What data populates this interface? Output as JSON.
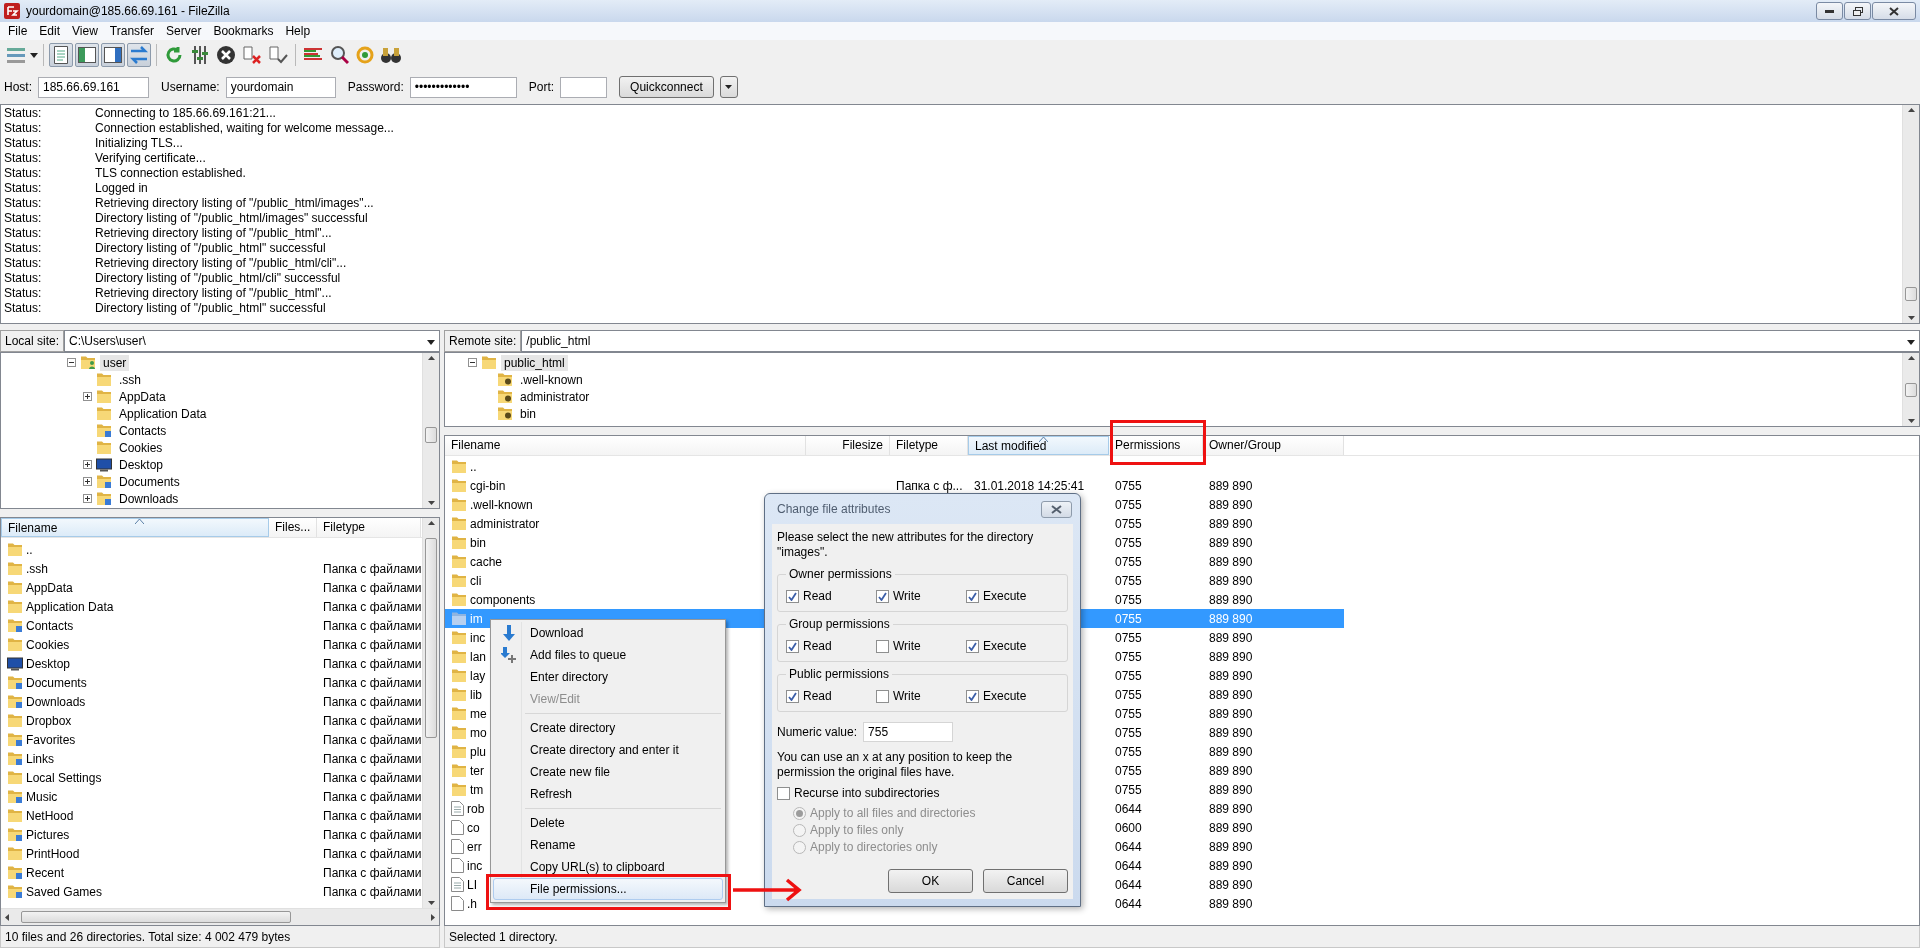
{
  "window": {
    "title": "yourdomain@185.66.69.161 - FileZilla"
  },
  "menu": [
    "File",
    "Edit",
    "View",
    "Transfer",
    "Server",
    "Bookmarks",
    "Help"
  ],
  "quickconnect": {
    "fields": [
      {
        "label": "Host:",
        "value": "185.66.69.161"
      },
      {
        "label": "Username:",
        "value": "yourdomain"
      },
      {
        "label": "Password:",
        "value": "•••••••••••••"
      },
      {
        "label": "Port:"
      }
    ],
    "button": "Quickconnect"
  },
  "log": [
    {
      "label": "Status:",
      "text": "Connecting to 185.66.69.161:21..."
    },
    {
      "label": "Status:",
      "text": "Connection established, waiting for welcome message..."
    },
    {
      "label": "Status:",
      "text": "Initializing TLS..."
    },
    {
      "label": "Status:",
      "text": "Verifying certificate..."
    },
    {
      "label": "Status:",
      "text": "TLS connection established."
    },
    {
      "label": "Status:",
      "text": "Logged in"
    },
    {
      "label": "Status:",
      "text": "Retrieving directory listing of \"/public_html/images\"..."
    },
    {
      "label": "Status:",
      "text": "Directory listing of \"/public_html/images\" successful"
    },
    {
      "label": "Status:",
      "text": "Retrieving directory listing of \"/public_html\"..."
    },
    {
      "label": "Status:",
      "text": "Directory listing of \"/public_html\" successful"
    },
    {
      "label": "Status:",
      "text": "Retrieving directory listing of \"/public_html/cli\"..."
    },
    {
      "label": "Status:",
      "text": "Directory listing of \"/public_html/cli\" successful"
    },
    {
      "label": "Status:",
      "text": "Retrieving directory listing of \"/public_html\"..."
    },
    {
      "label": "Status:",
      "text": "Directory listing of \"/public_html\" successful"
    }
  ],
  "local": {
    "label": "Local site:",
    "path": "C:\\Users\\user\\",
    "tree": [
      {
        "name": "user",
        "kind": "user-folder",
        "expanded": true,
        "selected": true,
        "children": [
          {
            "name": ".ssh",
            "kind": "folder",
            "selected": false
          },
          {
            "name": "AppData",
            "kind": "folder",
            "expanded": false,
            "selected": false
          },
          {
            "name": "Application Data",
            "kind": "folder",
            "selected": false
          },
          {
            "name": "Contacts",
            "kind": "special-folder",
            "selected": false
          },
          {
            "name": "Cookies",
            "kind": "folder",
            "selected": false
          },
          {
            "name": "Desktop",
            "kind": "desktop",
            "expanded": false,
            "selected": false
          },
          {
            "name": "Documents",
            "kind": "special-folder",
            "expanded": false,
            "selected": false
          },
          {
            "name": "Downloads",
            "kind": "special-folder",
            "expanded": false,
            "selected": false
          }
        ]
      }
    ],
    "columns": [
      {
        "label": "Filename",
        "sorted": true
      },
      {
        "label": "Files...",
        "sorted": false
      },
      {
        "label": "Filetype",
        "sorted": false
      }
    ],
    "rows": [
      {
        "name": "..",
        "kind": "folder"
      },
      {
        "name": ".ssh",
        "kind": "folder",
        "filetype": "Папка с файлами"
      },
      {
        "name": "AppData",
        "kind": "folder",
        "filetype": "Папка с файлами"
      },
      {
        "name": "Application Data",
        "kind": "folder",
        "filetype": "Папка с файлами"
      },
      {
        "name": "Contacts",
        "kind": "special-folder",
        "filetype": "Папка с файлами"
      },
      {
        "name": "Cookies",
        "kind": "folder",
        "filetype": "Папка с файлами"
      },
      {
        "name": "Desktop",
        "kind": "desktop",
        "filetype": "Папка с файлами"
      },
      {
        "name": "Documents",
        "kind": "special-folder",
        "filetype": "Папка с файлами"
      },
      {
        "name": "Downloads",
        "kind": "special-folder",
        "filetype": "Папка с файлами"
      },
      {
        "name": "Dropbox",
        "kind": "folder",
        "filetype": "Папка с файлами"
      },
      {
        "name": "Favorites",
        "kind": "special-folder",
        "filetype": "Папка с файлами"
      },
      {
        "name": "Links",
        "kind": "special-folder",
        "filetype": "Папка с файлами"
      },
      {
        "name": "Local Settings",
        "kind": "folder",
        "filetype": "Папка с файлами"
      },
      {
        "name": "Music",
        "kind": "special-folder",
        "filetype": "Папка с файлами"
      },
      {
        "name": "NetHood",
        "kind": "folder",
        "filetype": "Папка с файлами"
      },
      {
        "name": "Pictures",
        "kind": "special-folder",
        "filetype": "Папка с файлами"
      },
      {
        "name": "PrintHood",
        "kind": "folder",
        "filetype": "Папка с файлами"
      },
      {
        "name": "Recent",
        "kind": "special-folder",
        "filetype": "Папка с файлами"
      },
      {
        "name": "Saved Games",
        "kind": "special-folder",
        "filetype": "Папка с файлами"
      }
    ],
    "status": "10 files and 26 directories. Total size: 4 002 479 bytes"
  },
  "remote": {
    "label": "Remote site:",
    "path": "/public_html",
    "tree": [
      {
        "name": "public_html",
        "kind": "folder",
        "expanded": true,
        "selected": true,
        "children": [
          {
            "name": ".well-known",
            "kind": "question-folder",
            "selected": false
          },
          {
            "name": "administrator",
            "kind": "question-folder",
            "selected": false
          },
          {
            "name": "bin",
            "kind": "question-folder",
            "selected": false
          }
        ]
      }
    ],
    "columns": [
      {
        "label": "Filename",
        "sorted": false
      },
      {
        "label": "Filesize",
        "sorted": false
      },
      {
        "label": "Filetype",
        "sorted": false
      },
      {
        "label": "Last modified",
        "sorted": true
      },
      {
        "label": "Permissions",
        "sorted": false
      },
      {
        "label": "Owner/Group",
        "sorted": false
      }
    ],
    "rows": [
      {
        "name": "..",
        "kind": "folder",
        "selected": false
      },
      {
        "name": "cgi-bin",
        "kind": "folder",
        "selected": false,
        "filetype": "Папка с ф...",
        "modified": "31.01.2018 14:25:41",
        "permissions": "0755",
        "owner": "889 890"
      },
      {
        "name": ".well-known",
        "kind": "folder",
        "selected": false,
        "permissions": "0755",
        "owner": "889 890"
      },
      {
        "name": "administrator",
        "kind": "folder",
        "selected": false,
        "permissions": "0755",
        "owner": "889 890"
      },
      {
        "name": "bin",
        "kind": "folder",
        "selected": false,
        "permissions": "0755",
        "owner": "889 890"
      },
      {
        "name": "cache",
        "kind": "folder",
        "selected": false,
        "permissions": "0755",
        "owner": "889 890"
      },
      {
        "name": "cli",
        "kind": "folder",
        "selected": false,
        "permissions": "0755",
        "owner": "889 890"
      },
      {
        "name": "components",
        "kind": "folder",
        "selected": false,
        "permissions": "0755",
        "owner": "889 890"
      },
      {
        "name": "im",
        "kind": "folder",
        "selected": true,
        "permissions": "0755",
        "owner": "889 890"
      },
      {
        "name": "inc",
        "kind": "folder",
        "selected": false,
        "permissions": "0755",
        "owner": "889 890"
      },
      {
        "name": "lan",
        "kind": "folder",
        "selected": false,
        "permissions": "0755",
        "owner": "889 890"
      },
      {
        "name": "lay",
        "kind": "folder",
        "selected": false,
        "permissions": "0755",
        "owner": "889 890"
      },
      {
        "name": "lib",
        "kind": "folder",
        "selected": false,
        "permissions": "0755",
        "owner": "889 890"
      },
      {
        "name": "me",
        "kind": "folder",
        "selected": false,
        "permissions": "0755",
        "owner": "889 890"
      },
      {
        "name": "mo",
        "kind": "folder",
        "selected": false,
        "permissions": "0755",
        "owner": "889 890"
      },
      {
        "name": "plu",
        "kind": "folder",
        "selected": false,
        "permissions": "0755",
        "owner": "889 890"
      },
      {
        "name": "ter",
        "kind": "folder",
        "selected": false,
        "permissions": "0755",
        "owner": "889 890"
      },
      {
        "name": "tm",
        "kind": "folder",
        "selected": false,
        "permissions": "0755",
        "owner": "889 890"
      },
      {
        "name": "rob",
        "kind": "document",
        "selected": false,
        "permissions": "0644",
        "owner": "889 890"
      },
      {
        "name": "co",
        "kind": "file",
        "selected": false,
        "permissions": "0600",
        "owner": "889 890"
      },
      {
        "name": "err",
        "kind": "file",
        "selected": false,
        "permissions": "0644",
        "owner": "889 890"
      },
      {
        "name": "inc",
        "kind": "file",
        "selected": false,
        "permissions": "0644",
        "owner": "889 890"
      },
      {
        "name": "LI",
        "kind": "document",
        "selected": false,
        "permissions": "0644",
        "owner": "889 890"
      },
      {
        "name": ".h",
        "kind": "file",
        "selected": false,
        "permissions": "0644",
        "owner": "889 890"
      }
    ],
    "status": "Selected 1 directory."
  },
  "context_menu": {
    "sections": [
      {
        "items": [
          {
            "label": "Download",
            "selected": false,
            "disabled": false
          },
          {
            "label": "Add files to queue",
            "selected": false,
            "disabled": false
          },
          {
            "label": "Enter directory",
            "selected": false,
            "disabled": false
          },
          {
            "label": "View/Edit",
            "selected": false,
            "disabled": true
          }
        ]
      },
      {
        "items": [
          {
            "label": "Create directory",
            "selected": false,
            "disabled": false
          },
          {
            "label": "Create directory and enter it",
            "selected": false,
            "disabled": false
          },
          {
            "label": "Create new file",
            "selected": false,
            "disabled": false
          },
          {
            "label": "Refresh",
            "selected": false,
            "disabled": false
          }
        ]
      },
      {
        "items": [
          {
            "label": "Delete",
            "selected": false,
            "disabled": false
          },
          {
            "label": "Rename",
            "selected": false,
            "disabled": false
          },
          {
            "label": "Copy URL(s) to clipboard",
            "selected": false,
            "disabled": false
          },
          {
            "label": "File permissions...",
            "selected": true,
            "disabled": false
          }
        ]
      }
    ]
  },
  "dialog": {
    "title": "Change file attributes",
    "intro": "Please select the new attributes for the directory \"images\".",
    "groups": [
      {
        "title": "Owner permissions",
        "options": [
          {
            "label": "Read",
            "checked": true
          },
          {
            "label": "Write",
            "checked": true
          },
          {
            "label": "Execute",
            "checked": true
          }
        ]
      },
      {
        "title": "Group permissions",
        "options": [
          {
            "label": "Read",
            "checked": true
          },
          {
            "label": "Write",
            "checked": false
          },
          {
            "label": "Execute",
            "checked": true
          }
        ]
      },
      {
        "title": "Public permissions",
        "options": [
          {
            "label": "Read",
            "checked": true
          },
          {
            "label": "Write",
            "checked": false
          },
          {
            "label": "Execute",
            "checked": true
          }
        ]
      }
    ],
    "numeric_label": "Numeric value:",
    "numeric_value": "755",
    "note": "You can use an x at any position to keep the permission the original files have.",
    "recurse": {
      "label": "Recurse into subdirectories",
      "checked": false
    },
    "apply_options": [
      {
        "label": "Apply to all files and directories",
        "selected": true,
        "disabled": true
      },
      {
        "label": "Apply to files only",
        "selected": false,
        "disabled": true
      },
      {
        "label": "Apply to directories only",
        "selected": false,
        "disabled": true
      }
    ],
    "buttons": [
      "OK",
      "Cancel"
    ]
  }
}
